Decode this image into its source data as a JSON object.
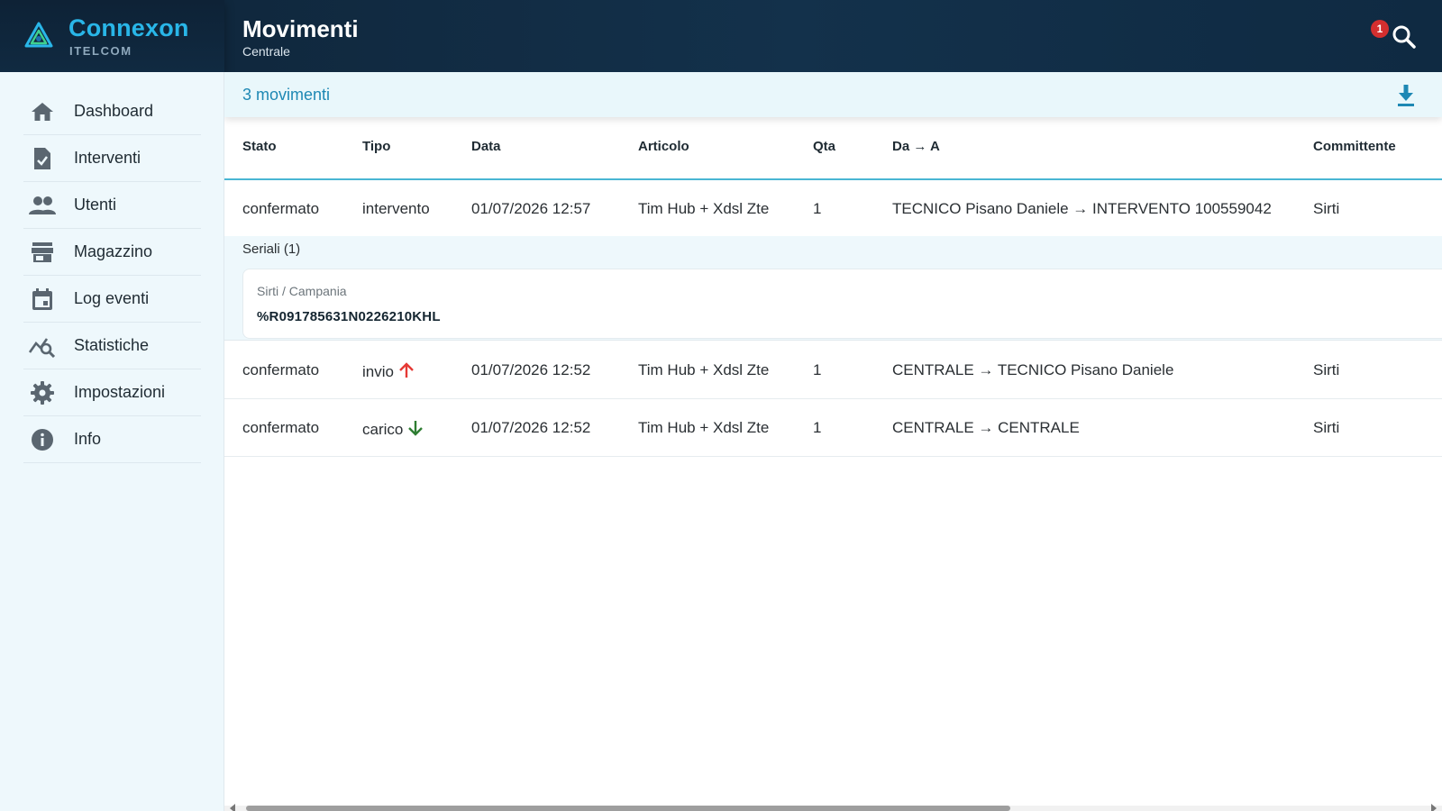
{
  "brand": {
    "name": "Connexon",
    "sub": "ITELCOM"
  },
  "header": {
    "title": "Movimenti",
    "subtitle": "Centrale",
    "notification_count": "1"
  },
  "sidebar": {
    "items": [
      {
        "label": "Dashboard",
        "icon": "home-icon"
      },
      {
        "label": "Interventi",
        "icon": "clipboard-check-icon"
      },
      {
        "label": "Utenti",
        "icon": "users-icon"
      },
      {
        "label": "Magazzino",
        "icon": "store-icon"
      },
      {
        "label": "Log eventi",
        "icon": "calendar-icon"
      },
      {
        "label": "Statistiche",
        "icon": "chart-search-icon"
      },
      {
        "label": "Impostazioni",
        "icon": "gear-icon"
      },
      {
        "label": "Info",
        "icon": "info-icon"
      }
    ]
  },
  "main": {
    "count_label": "3 movimenti",
    "columns": [
      "Stato",
      "Tipo",
      "Data",
      "Articolo",
      "Qta",
      "Da → A",
      "Committente"
    ],
    "rows": [
      {
        "stato": "confermato",
        "tipo": "intervento",
        "data": "01/07/2026 12:57",
        "articolo": "Tim Hub + Xdsl Zte",
        "qta": "1",
        "da_a": "TECNICO Pisano Daniele → INTERVENTO 100559042",
        "committente": "Sirti"
      },
      {
        "stato": "confermato",
        "tipo": "invio",
        "tipo_icon": "arrow-up-icon",
        "data": "01/07/2026 12:52",
        "articolo": "Tim Hub + Xdsl Zte",
        "qta": "1",
        "da_a": "CENTRALE → TECNICO Pisano Daniele",
        "committente": "Sirti"
      },
      {
        "stato": "confermato",
        "tipo": "carico",
        "tipo_icon": "arrow-down-icon",
        "data": "01/07/2026 12:52",
        "articolo": "Tim Hub + Xdsl Zte",
        "qta": "1",
        "da_a": "CENTRALE → CENTRALE",
        "committente": "Sirti"
      }
    ],
    "serials": {
      "title": "Seriali (1)",
      "items": [
        {
          "group": "Sirti / Campania",
          "code": "%R091785631N0226210KHL"
        }
      ]
    }
  },
  "colors": {
    "header_bg": "#13314b",
    "brand": "#29b6e8",
    "accent": "#1e88b4",
    "sidebar_bg": "#eef8fc",
    "arrow_up": "#e53935",
    "arrow_down": "#2e7d32"
  }
}
